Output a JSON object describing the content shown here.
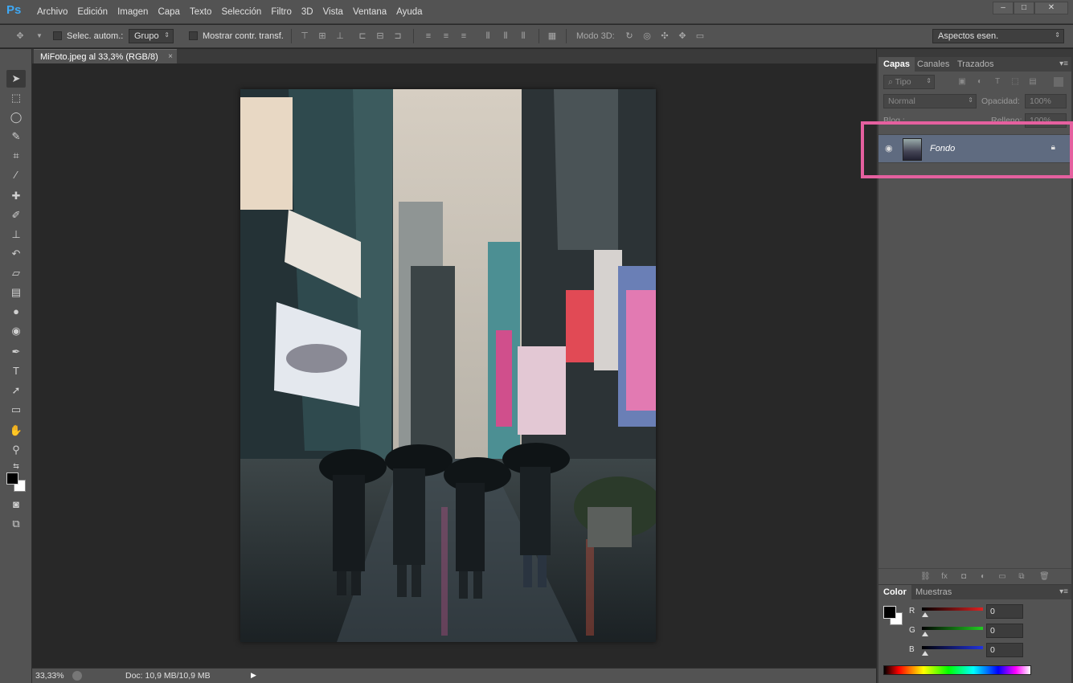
{
  "app": {
    "logo": "Ps",
    "menu": [
      "Archivo",
      "Edición",
      "Imagen",
      "Capa",
      "Texto",
      "Selección",
      "Filtro",
      "3D",
      "Vista",
      "Ventana",
      "Ayuda"
    ],
    "window_controls": {
      "minimize": "–",
      "maximize": "□",
      "close": "✕"
    }
  },
  "options": {
    "auto_select_label": "Selec. autom.:",
    "auto_select_value": "Grupo",
    "show_transform_label": "Mostrar contr. transf.",
    "mode3d_label": "Modo 3D:",
    "workspace_value": "Aspectos esen."
  },
  "document": {
    "tab_title": "MiFoto.jpeg al 33,3% (RGB/8)",
    "tab_close": "×"
  },
  "status": {
    "zoom": "33,33%",
    "doc_info": "Doc: 10,9 MB/10,9 MB"
  },
  "layers_panel": {
    "tabs": [
      "Capas",
      "Canales",
      "Trazados"
    ],
    "active_tab": "Capas",
    "filter_label": "Tipo",
    "blend_mode": "Normal",
    "opacity_label": "Opacidad:",
    "opacity_value": "100%",
    "lock_label": "Bloq.:",
    "fill_label": "Relleno:",
    "fill_value": "100%",
    "layers": [
      {
        "name": "Fondo",
        "visible": true,
        "locked": true
      }
    ]
  },
  "color_panel": {
    "tabs": [
      "Color",
      "Muestras"
    ],
    "active_tab": "Color",
    "channels": [
      {
        "label": "R",
        "value": "0",
        "color": "#cc2222"
      },
      {
        "label": "G",
        "value": "0",
        "color": "#22aa22"
      },
      {
        "label": "B",
        "value": "0",
        "color": "#2233cc"
      }
    ],
    "foreground": "#000000",
    "background": "#ffffff"
  },
  "highlight_color": "#e5609f"
}
